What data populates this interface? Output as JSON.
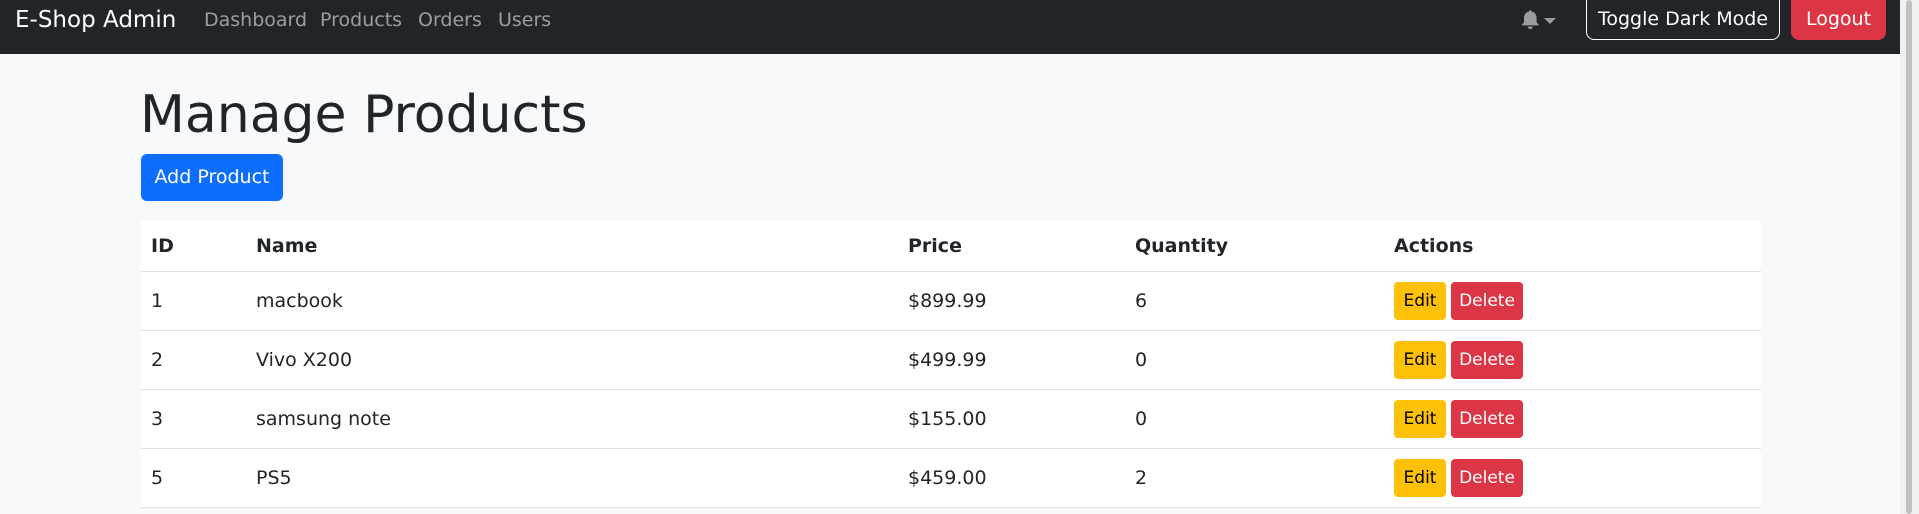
{
  "navbar": {
    "brand": "E-Shop Admin",
    "links": [
      "Dashboard",
      "Products",
      "Orders",
      "Users"
    ],
    "toggle_dark_mode_label": "Toggle Dark Mode",
    "logout_label": "Logout",
    "icons": [
      "bell-icon",
      "caret-down-icon"
    ]
  },
  "page": {
    "title": "Manage Products",
    "add_button_label": "Add Product"
  },
  "table": {
    "headers": [
      "ID",
      "Name",
      "Price",
      "Quantity",
      "Actions"
    ],
    "rows": [
      {
        "id": "1",
        "name": "macbook",
        "price": "$899.99",
        "quantity": "6"
      },
      {
        "id": "2",
        "name": "Vivo X200",
        "price": "$499.99",
        "quantity": "0"
      },
      {
        "id": "3",
        "name": "samsung note",
        "price": "$155.00",
        "quantity": "0"
      },
      {
        "id": "5",
        "name": "PS5",
        "price": "$459.00",
        "quantity": "2"
      }
    ],
    "edit_label": "Edit",
    "delete_label": "Delete"
  },
  "colors": {
    "navbar_bg": "#212529",
    "primary": "#0d6efd",
    "danger": "#dc3545",
    "warning": "#ffc107",
    "page_bg": "#f8f9fa"
  }
}
